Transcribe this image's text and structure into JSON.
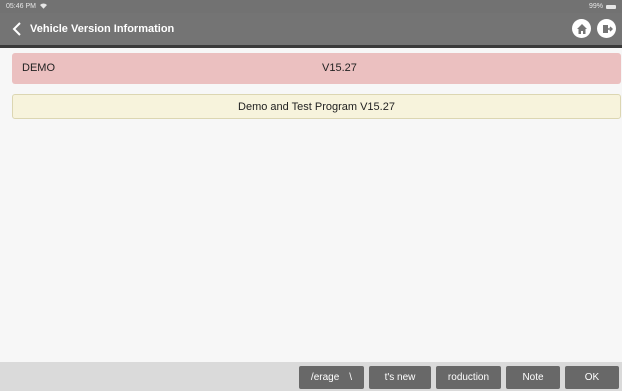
{
  "status_bar": {
    "time": "05:46 PM",
    "battery_text": "99%"
  },
  "header": {
    "title": "Vehicle Version Information"
  },
  "rows": {
    "first": {
      "name": "DEMO",
      "version": "V15.27"
    },
    "second": {
      "text": "Demo and Test Program V15.27"
    }
  },
  "colors": {
    "row_highlight": "#ebc0c0",
    "row_note": "#f7f3dc",
    "button": "#686868",
    "header": "#747474"
  },
  "toolbar": {
    "buttons": [
      {
        "label": "/erage",
        "suffix": "\\"
      },
      {
        "label": "t's new"
      },
      {
        "label": "roduction"
      },
      {
        "label": "Note"
      },
      {
        "label": "OK"
      }
    ]
  }
}
